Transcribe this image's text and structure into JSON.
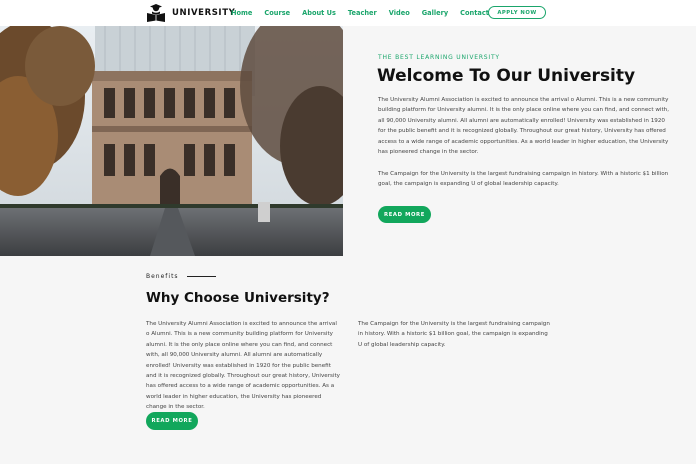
{
  "header": {
    "logo_text": "UNIVERSITY",
    "nav": [
      "Home",
      "Course",
      "About Us",
      "Teacher",
      "Video",
      "Gallery",
      "Contact Us"
    ],
    "apply_label": "APPLY NOW"
  },
  "hero": {
    "eyebrow": "THE BEST LEARNING UNIVERSITY",
    "title": "Welcome To Our University",
    "paragraph1": "The University Alumni Association is excited to announce the arrival o Alumni. This is a new community building platform for University alumni. It is the only place online where you can find, and connect with, all 90,000 University alumni. All alumni are automatically enrolled! University was established in 1920 for the public benefit and it is recognized globally. Throughout our great history, University has offered access to a wide range of academic opportunities. As a world leader in higher education, the University has pioneered change in the sector.",
    "paragraph2": "The Campaign for the University is the largest fundraising campaign in history. With a historic $1 billion goal, the campaign is expanding U of global leadership capacity.",
    "button_label": "READ MORE"
  },
  "benefits": {
    "label": "Benefits",
    "title": "Why Choose University?",
    "column1": "The University Alumni Association is excited to announce the arrival o Alumni. This is a new community building platform for University alumni. It is the only place online where you can find, and connect with, all 90,000 University alumni. All alumni are automatically enrolled! University was established in 1920 for the public benefit and it is recognized globally. Throughout our great history, University has offered access to a wide range of academic opportunities. As a world leader in higher education, the University has pioneered change in the sector.",
    "column2": "The Campaign for the University is the largest fundraising campaign in history. With a historic $1 billion goal, the campaign is expanding U of global leadership capacity.",
    "button_label": "READ MORE"
  },
  "colors": {
    "accent": "#1aa56b",
    "button": "#12a75c"
  }
}
